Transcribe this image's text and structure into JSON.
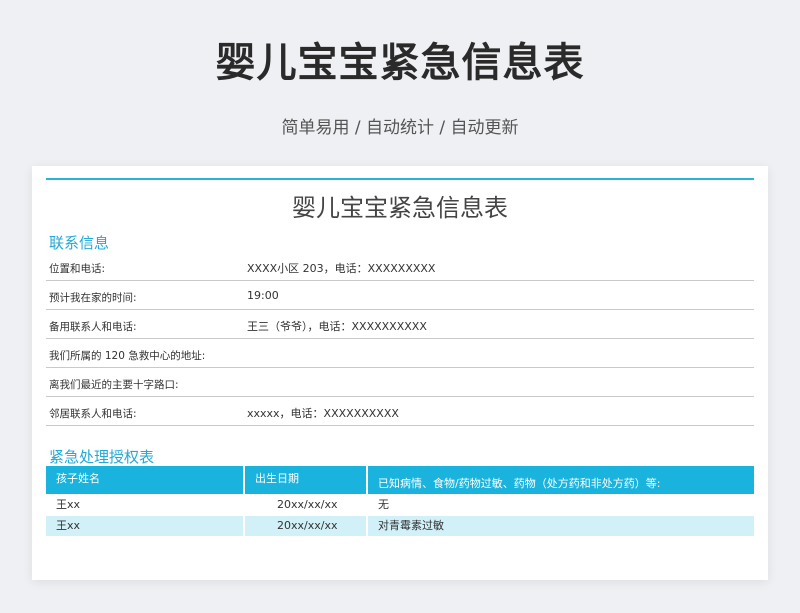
{
  "hero": {
    "title": "婴儿宝宝紧急信息表",
    "subtitle": "简单易用 / 自动统计 / 自动更新"
  },
  "document": {
    "title": "婴儿宝宝紧急信息表",
    "contact_section": {
      "heading": "联系信息",
      "rows": [
        {
          "label": "位置和电话:",
          "value": "XXXX小区 203，电话：XXXXXXXXX"
        },
        {
          "label": "预计我在家的时间:",
          "value": "19:00"
        },
        {
          "label": "备用联系人和电话:",
          "value": "王三（爷爷），电话：XXXXXXXXXX"
        },
        {
          "label": "我们所属的 120 急救中心的地址:",
          "value": ""
        },
        {
          "label": "离我们最近的主要十字路口:",
          "value": ""
        },
        {
          "label": "邻居联系人和电话:",
          "value": "xxxxx，电话：XXXXXXXXXX"
        }
      ]
    },
    "authorization_section": {
      "heading": "紧急处理授权表",
      "headers": [
        "孩子姓名",
        "出生日期",
        "已知病情、食物/药物过敏、药物（处方药和非处方药）等:"
      ],
      "rows": [
        [
          "王xx",
          "20xx/xx/xx",
          "无"
        ],
        [
          "王xx",
          "20xx/xx/xx",
          "对青霉素过敏"
        ]
      ]
    },
    "colors": {
      "accent": "#19b3de",
      "accent_light": "#d1f0f8",
      "heading": "#23a9d6"
    }
  }
}
